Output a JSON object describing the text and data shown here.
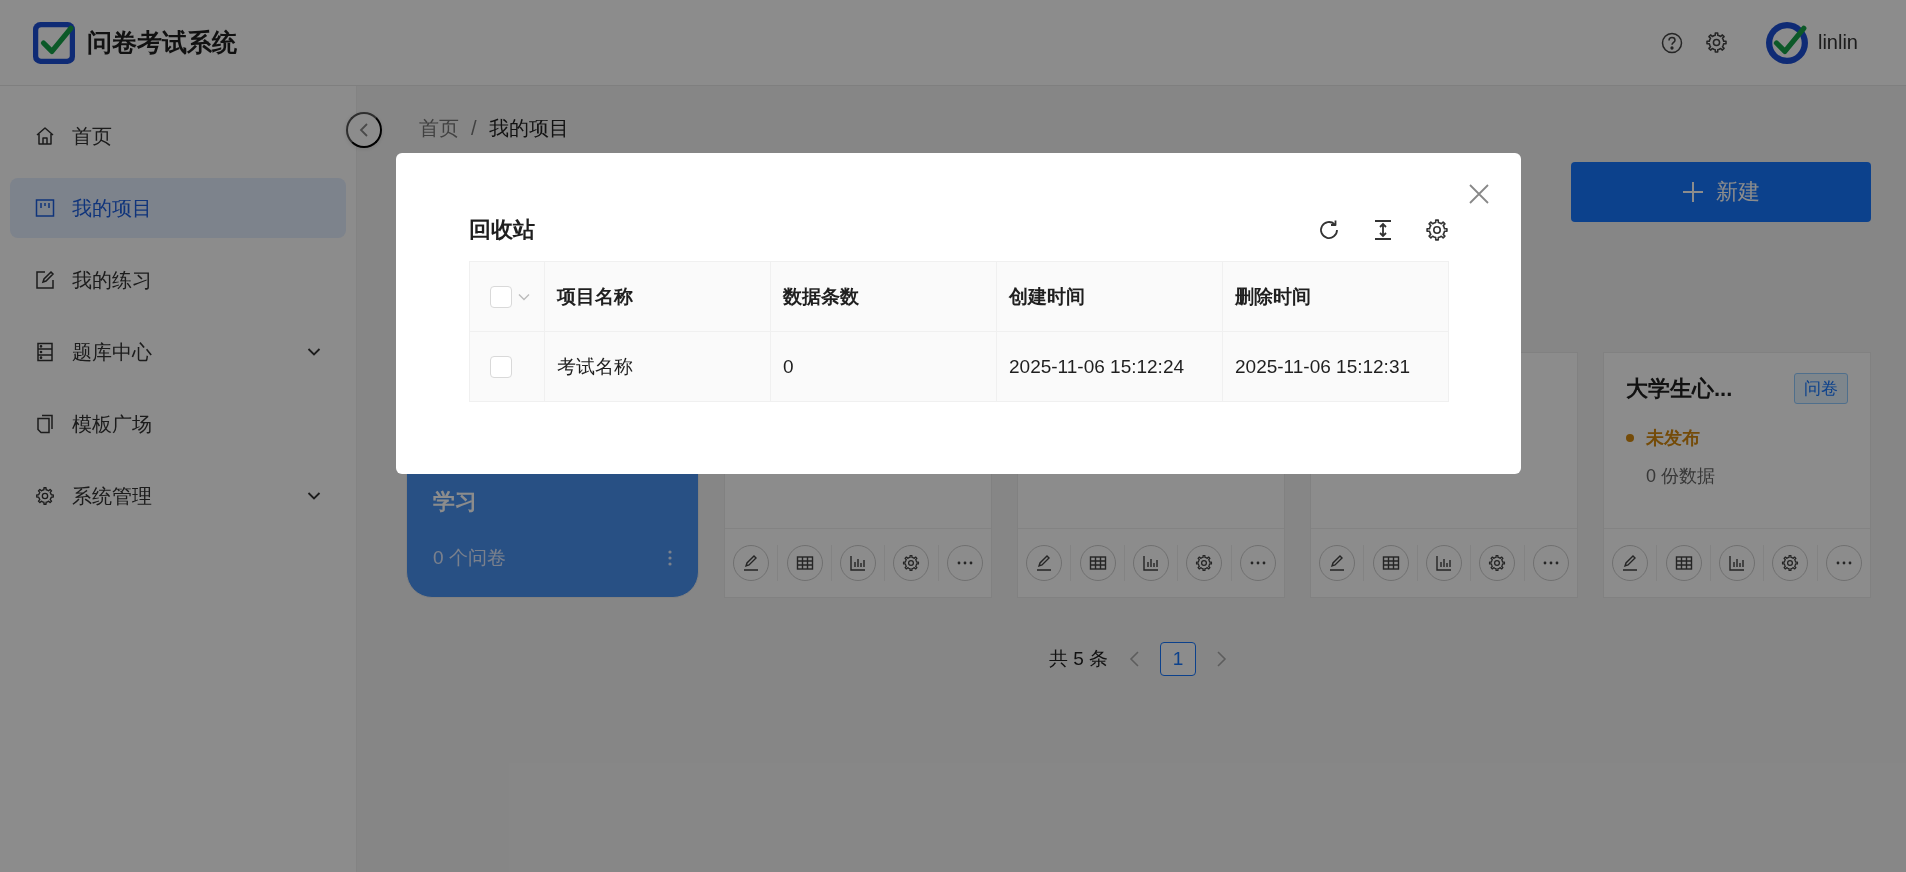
{
  "header": {
    "title": "问卷考试系统",
    "user": "linlin"
  },
  "sidebar": {
    "items": [
      {
        "label": "首页",
        "selected": false,
        "has_submenu": false
      },
      {
        "label": "我的项目",
        "selected": true,
        "has_submenu": false
      },
      {
        "label": "我的练习",
        "selected": false,
        "has_submenu": false
      },
      {
        "label": "题库中心",
        "selected": false,
        "has_submenu": true
      },
      {
        "label": "模板广场",
        "selected": false,
        "has_submenu": false
      },
      {
        "label": "系统管理",
        "selected": false,
        "has_submenu": true
      }
    ]
  },
  "breadcrumb": {
    "separator": "/",
    "items": [
      {
        "label": "首页",
        "selected": false
      },
      {
        "label": "我的项目",
        "selected": true
      }
    ]
  },
  "new_button": {
    "label": "新建"
  },
  "cards": [
    {
      "kind": "folder",
      "title": "学习",
      "count": "0 个问卷"
    },
    {
      "kind": "project"
    },
    {
      "kind": "project"
    },
    {
      "kind": "project"
    },
    {
      "kind": "project",
      "title": "大学生心...",
      "tag": "问卷",
      "status": "未发布",
      "data_count": "0 份数据"
    }
  ],
  "pagination": {
    "total": "共 5 条",
    "pages": [
      {
        "label": "1",
        "selected": true
      }
    ]
  },
  "dialog": {
    "title": "回收站",
    "table": {
      "all_checked": false,
      "columns": [
        "项目名称",
        "数据条数",
        "创建时间",
        "删除时间"
      ],
      "rows": [
        {
          "checked": false,
          "cells": [
            "考试名称",
            "0",
            "2025-11-06 15:12:24",
            "2025-11-06 15:12:31"
          ]
        }
      ]
    }
  }
}
